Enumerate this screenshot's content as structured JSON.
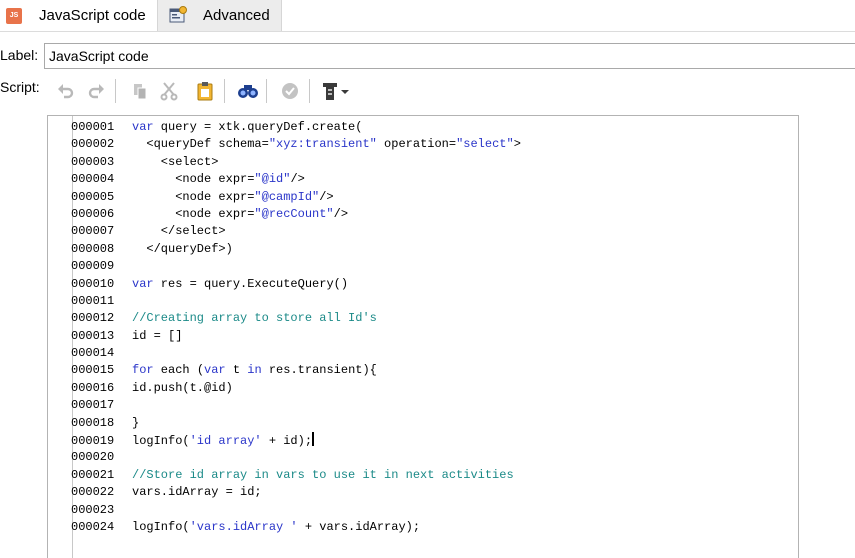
{
  "tabs": [
    {
      "label": "JavaScript code",
      "icon": "js-file-icon",
      "active": true
    },
    {
      "label": "Advanced",
      "icon": "advanced-settings-icon",
      "active": false
    }
  ],
  "form": {
    "label_caption": "Label:",
    "label_value": "JavaScript code",
    "script_caption": "Script:"
  },
  "toolbar": {
    "buttons": [
      "undo-icon",
      "redo-icon",
      "copy-icon",
      "cut-icon",
      "paste-icon",
      "find-icon",
      "check-syntax-icon",
      "insert-menu-icon"
    ]
  },
  "code_lines": [
    {
      "n": "000001",
      "tokens": [
        [
          "kw",
          "var"
        ],
        [
          "t",
          " query = xtk.queryDef.create("
        ]
      ]
    },
    {
      "n": "000002",
      "tokens": [
        [
          "t",
          "  <queryDef schema="
        ],
        [
          "str",
          "\"xyz:transient\""
        ],
        [
          "t",
          " operation="
        ],
        [
          "str",
          "\"select\""
        ],
        [
          "t",
          ">"
        ]
      ]
    },
    {
      "n": "000003",
      "tokens": [
        [
          "t",
          "    <select>"
        ]
      ]
    },
    {
      "n": "000004",
      "tokens": [
        [
          "t",
          "      <node expr="
        ],
        [
          "str",
          "\"@id\""
        ],
        [
          "t",
          "/>"
        ]
      ]
    },
    {
      "n": "000005",
      "tokens": [
        [
          "t",
          "      <node expr="
        ],
        [
          "str",
          "\"@campId\""
        ],
        [
          "t",
          "/>"
        ]
      ]
    },
    {
      "n": "000006",
      "tokens": [
        [
          "t",
          "      <node expr="
        ],
        [
          "str",
          "\"@recCount\""
        ],
        [
          "t",
          "/>"
        ]
      ]
    },
    {
      "n": "000007",
      "tokens": [
        [
          "t",
          "    </select>"
        ]
      ]
    },
    {
      "n": "000008",
      "tokens": [
        [
          "t",
          "  </queryDef>)"
        ]
      ]
    },
    {
      "n": "000009",
      "tokens": []
    },
    {
      "n": "000010",
      "tokens": [
        [
          "kw",
          "var"
        ],
        [
          "t",
          " res = query.ExecuteQuery()"
        ]
      ]
    },
    {
      "n": "000011",
      "tokens": []
    },
    {
      "n": "000012",
      "tokens": [
        [
          "cm",
          "//Creating array to store all Id's"
        ]
      ]
    },
    {
      "n": "000013",
      "tokens": [
        [
          "t",
          "id = []"
        ]
      ]
    },
    {
      "n": "000014",
      "tokens": []
    },
    {
      "n": "000015",
      "tokens": [
        [
          "kw",
          "for"
        ],
        [
          "t",
          " each ("
        ],
        [
          "kw",
          "var"
        ],
        [
          "t",
          " t "
        ],
        [
          "kw",
          "in"
        ],
        [
          "t",
          " res.transient){"
        ]
      ]
    },
    {
      "n": "000016",
      "tokens": [
        [
          "t",
          "id.push(t.@id)"
        ]
      ]
    },
    {
      "n": "000017",
      "tokens": []
    },
    {
      "n": "000018",
      "tokens": [
        [
          "t",
          "}"
        ]
      ]
    },
    {
      "n": "000019",
      "tokens": [
        [
          "t",
          "logInfo("
        ],
        [
          "str",
          "'id array'"
        ],
        [
          "t",
          " + id);"
        ]
      ],
      "caret": true
    },
    {
      "n": "000020",
      "tokens": []
    },
    {
      "n": "000021",
      "tokens": [
        [
          "cm",
          "//Store id array in vars to use it in next activities"
        ]
      ]
    },
    {
      "n": "000022",
      "tokens": [
        [
          "t",
          "vars.idArray = id;"
        ]
      ]
    },
    {
      "n": "000023",
      "tokens": []
    },
    {
      "n": "000024",
      "tokens": [
        [
          "t",
          "logInfo("
        ],
        [
          "str",
          "'vars.idArray '"
        ],
        [
          "t",
          " + vars.idArray);"
        ]
      ]
    }
  ]
}
